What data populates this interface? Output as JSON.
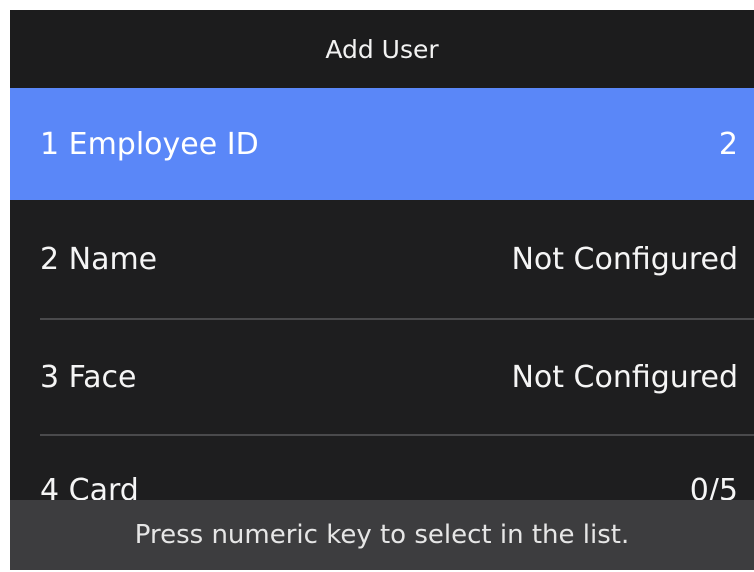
{
  "header": {
    "title": "Add User"
  },
  "menu": {
    "items": [
      {
        "label": "1 Employee ID",
        "value": "2",
        "selected": true
      },
      {
        "label": "2 Name",
        "value": "Not Configured",
        "selected": false
      },
      {
        "label": "3 Face",
        "value": "Not Configured",
        "selected": false
      },
      {
        "label": "4 Card",
        "value": "0/5",
        "selected": false
      }
    ]
  },
  "footer": {
    "hint": "Press numeric key to select in the list."
  },
  "colors": {
    "selected_row": "#5a87f8",
    "background": "#1e1e1f",
    "hint_bar": "#3d3d3f"
  }
}
